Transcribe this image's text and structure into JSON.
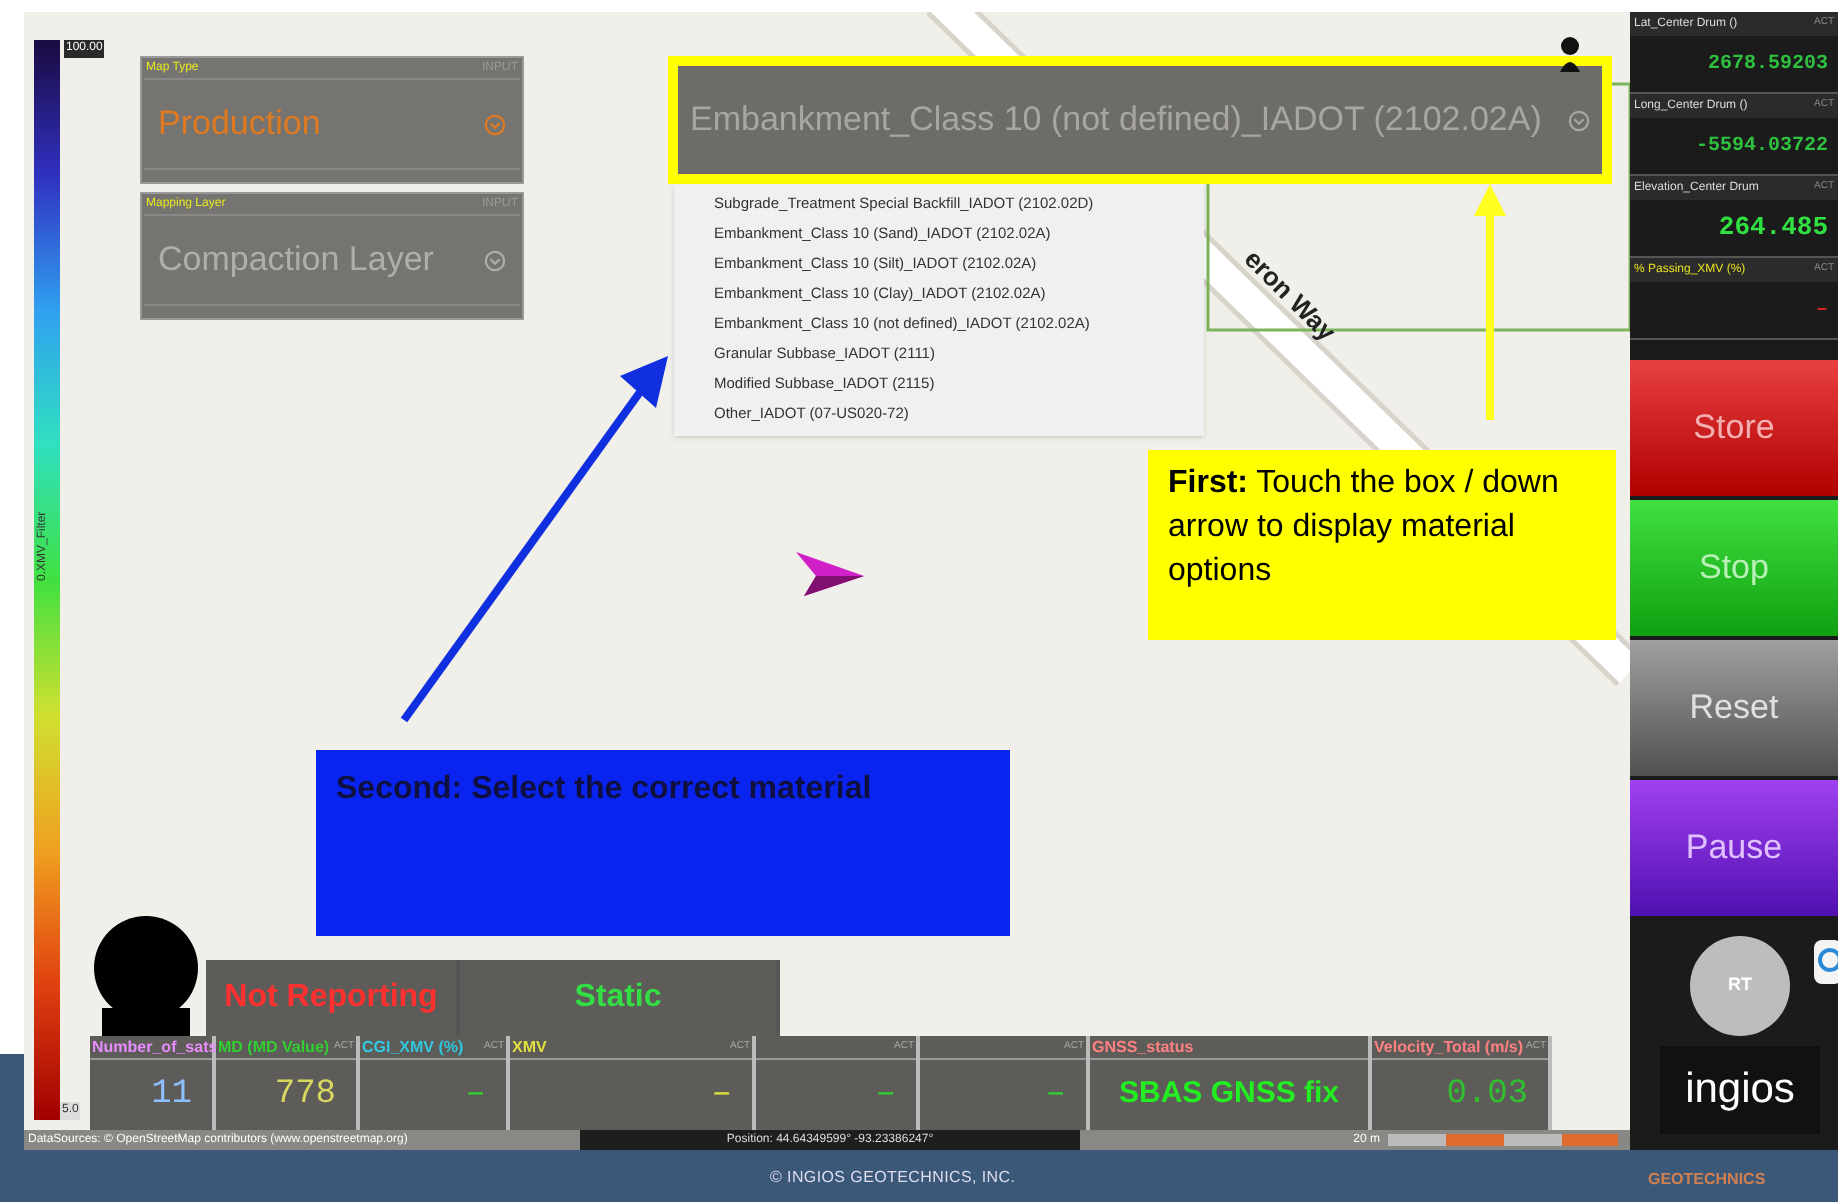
{
  "legend": {
    "max": "100.00",
    "title": "0.XMV_Filter",
    "min": "5.0"
  },
  "map_type": {
    "label": "Map Type",
    "tag": "INPUT",
    "value": "Production"
  },
  "mapping_layer": {
    "label": "Mapping Layer",
    "tag": "INPUT",
    "value": "Compaction Layer"
  },
  "material_selection": {
    "value": "Embankment_Class 10 (not defined)_IADOT (2102.02A)",
    "options": [
      "Subgrade_Treatment Special Backfill_IADOT (2102.02D)",
      "Embankment_Class 10 (Sand)_IADOT (2102.02A)",
      "Embankment_Class 10 (Silt)_IADOT (2102.02A)",
      "Embankment_Class 10 (Clay)_IADOT (2102.02A)",
      "Embankment_Class 10 (not defined)_IADOT (2102.02A)",
      "Granular Subbase_IADOT (2111)",
      "Modified Subbase_IADOT (2115)",
      "Other_IADOT (07-US020-72)"
    ]
  },
  "map": {
    "street": "eron Way"
  },
  "callouts": [
    {
      "kind": "first",
      "text": "**First:** Touch the box / down arrow to display material options"
    },
    {
      "kind": "second",
      "text": "Second: Select the correct material"
    }
  ],
  "status_tiles": [
    {
      "text": "Not Reporting",
      "color": "#ff3030"
    },
    {
      "text": "Static",
      "color": "#33dd44"
    }
  ],
  "data_tiles": [
    {
      "label": {
        "text": "Number_of_sats",
        "color": "#e88cff"
      },
      "value": "11",
      "color": "#8cc0ff"
    },
    {
      "label": {
        "text": "MD (MD Value)",
        "color": "#30d030"
      },
      "tag": "ACT",
      "value": "778",
      "color": "#d8d860"
    },
    {
      "label": {
        "text": "CGI_XMV (%)",
        "color": "#30c8e0"
      },
      "tag": "ACT",
      "value": "–",
      "color": "#30d030"
    },
    {
      "label": {
        "text": "XMV",
        "color": "#e0e040"
      },
      "tag": "ACT",
      "value": "–",
      "color": "#e0e040"
    },
    {
      "tag": "ACT",
      "value": "–",
      "color": "#30d030"
    },
    {
      "tag": "ACT",
      "value": "–",
      "color": "#30d030"
    },
    {
      "label": {
        "text": "GNSS_status",
        "color": "#ff8080"
      },
      "value": "SBAS GNSS fix",
      "color": "#22ee22"
    },
    {
      "label": {
        "text": "Velocity_Total (m/s)",
        "color": "#ff8080"
      },
      "tag": "ACT",
      "value": "0.03",
      "color": "#30c030"
    }
  ],
  "attribution": "DataSources: © OpenStreetMap contributors (www.openstreetmap.org)",
  "position": "Position: 44.64349599° -93.23386247°",
  "scale": "20 m",
  "readouts": [
    {
      "label": "Lat_Center Drum ()",
      "tag": "ACT",
      "value": "2678.59203",
      "color": "#30c040"
    },
    {
      "label": "Long_Center Drum ()",
      "tag": "ACT",
      "value": "-5594.03722",
      "color": "#30c040"
    },
    {
      "label": "Elevation_Center Drum",
      "tag": "ACT",
      "value": "264.485",
      "color": "#30e040"
    },
    {
      "label": "% Passing_XMV (%)",
      "tag": "ACT",
      "value": "–",
      "color": "#e02020"
    }
  ],
  "buttons": [
    {
      "label": "Store",
      "kind": "store"
    },
    {
      "label": "Stop",
      "kind": "stop"
    },
    {
      "label": "Reset",
      "kind": "reset"
    },
    {
      "label": "Pause",
      "kind": "pause"
    }
  ],
  "rt_button": "RT",
  "logo": "ingios",
  "logo_sub": "GEOTECHNICS",
  "footer": "© INGIOS GEOTECHNICS, INC."
}
